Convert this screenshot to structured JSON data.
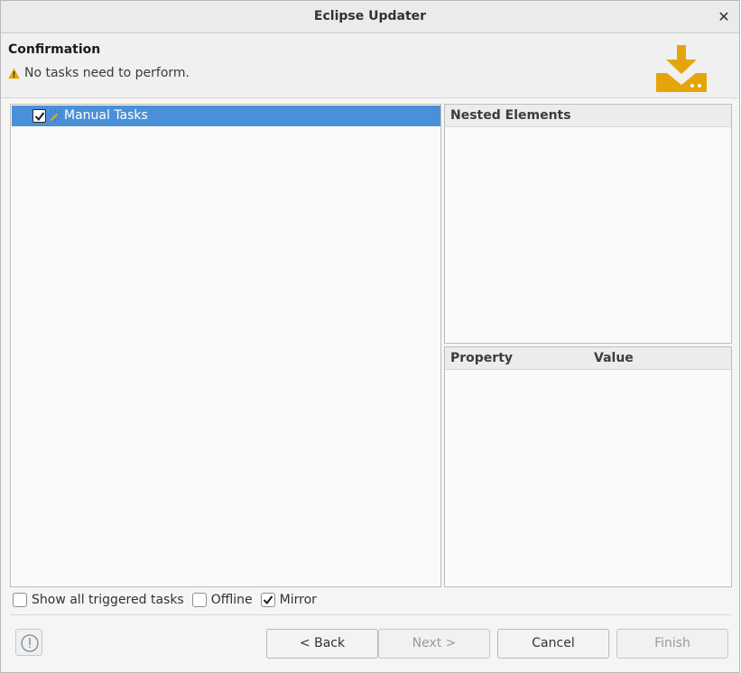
{
  "window": {
    "title": "Eclipse Updater",
    "close_glyph": "✕"
  },
  "header": {
    "title": "Confirmation",
    "message": "No tasks need to perform.",
    "message_icon": "warning-icon",
    "banner_icon": "download-icon",
    "accent_color": "#e5a50a"
  },
  "tree": {
    "items": [
      {
        "label": "Manual Tasks",
        "checked": true,
        "selected": true,
        "icon": "manual-task-icon"
      }
    ],
    "selection_color": "#4a90d9"
  },
  "nested_panel": {
    "header": "Nested Elements"
  },
  "properties_panel": {
    "columns": [
      "Property",
      "Value"
    ]
  },
  "options": [
    {
      "label": "Show all triggered tasks",
      "checked": false
    },
    {
      "label": "Offline",
      "checked": false
    },
    {
      "label": "Mirror",
      "checked": true
    }
  ],
  "buttons": {
    "back": "< Back",
    "next": "Next >",
    "cancel": "Cancel",
    "finish": "Finish"
  }
}
